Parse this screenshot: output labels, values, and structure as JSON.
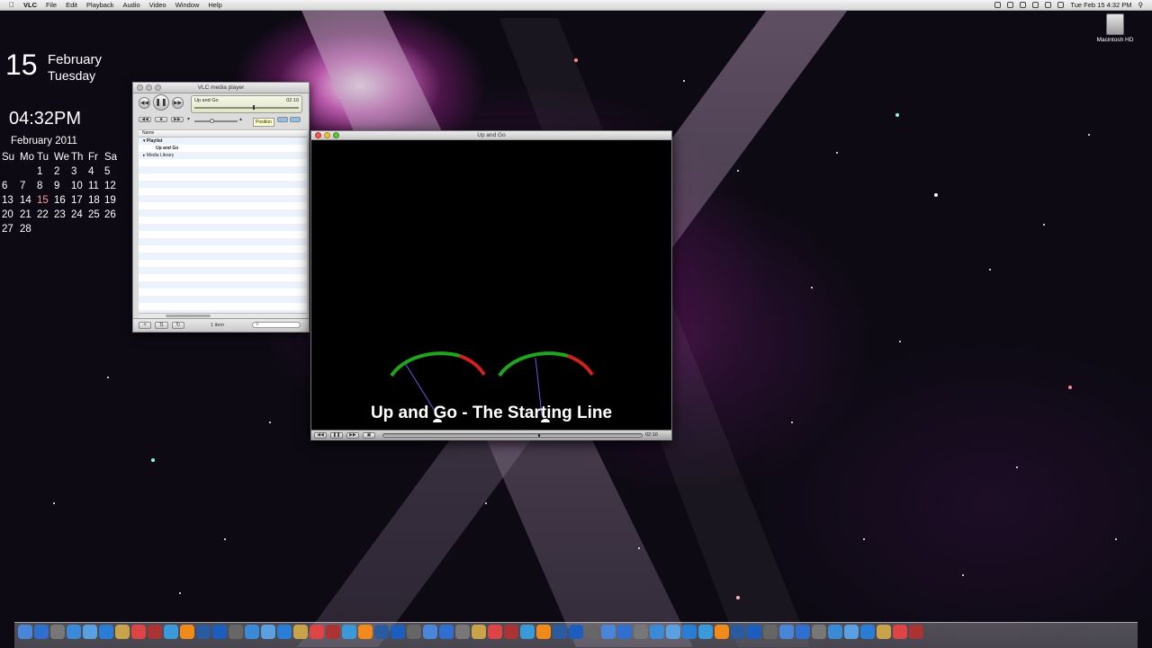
{
  "menubar": {
    "app_name": "VLC",
    "menus": [
      "File",
      "Edit",
      "Playback",
      "Audio",
      "Video",
      "Window",
      "Help"
    ],
    "clock": "Tue Feb 15  4:32 PM"
  },
  "desktop": {
    "date_widget": {
      "day_number": "15",
      "month": "February",
      "weekday": "Tuesday"
    },
    "clock_widget": {
      "time": "04:32PM"
    },
    "calendar": {
      "title": "February 2011",
      "weekdays": [
        "Su",
        "Mo",
        "Tu",
        "We",
        "Th",
        "Fr",
        "Sa"
      ],
      "weeks": [
        [
          "",
          "",
          "1",
          "2",
          "3",
          "4",
          "5"
        ],
        [
          "6",
          "7",
          "8",
          "9",
          "10",
          "11",
          "12"
        ],
        [
          "13",
          "14",
          "15",
          "16",
          "17",
          "18",
          "19"
        ],
        [
          "20",
          "21",
          "22",
          "23",
          "24",
          "25",
          "26"
        ],
        [
          "27",
          "28",
          "",
          "",
          "",
          "",
          ""
        ]
      ],
      "today": "15"
    },
    "hard_drive": {
      "label": "Macintosh HD"
    }
  },
  "vlc_controller": {
    "title": "VLC media player",
    "now_playing": "Up and Go",
    "time": "02:10",
    "tooltip": "Position",
    "playlist": {
      "column_header": "Name",
      "items": [
        {
          "label": "Playlist",
          "kind": "group"
        },
        {
          "label": "Up and Go",
          "kind": "track"
        },
        {
          "label": "Media Library",
          "kind": "group"
        }
      ],
      "count_label": "1 item"
    },
    "playback_progress": 0.56,
    "volume_level": 0.4
  },
  "video_window": {
    "title": "Up and Go",
    "caption": "Up and Go - The Starting Line",
    "time": "02:10",
    "playback_progress": 0.6,
    "colors": {
      "gauge_green": "#1fa51f",
      "gauge_red": "#d0201f",
      "needle": "#6a5be0"
    }
  },
  "dock": {
    "icons": [
      "finder-icon",
      "safari-icon",
      "system-preferences-icon",
      "preview-icon",
      "network-icon",
      "chat-icon",
      "folder-icon",
      "calendar-icon",
      "photo-booth-icon",
      "app-store-icon",
      "vlc-icon",
      "xcode-icon",
      "photoshop-icon",
      "trash-icon"
    ]
  }
}
